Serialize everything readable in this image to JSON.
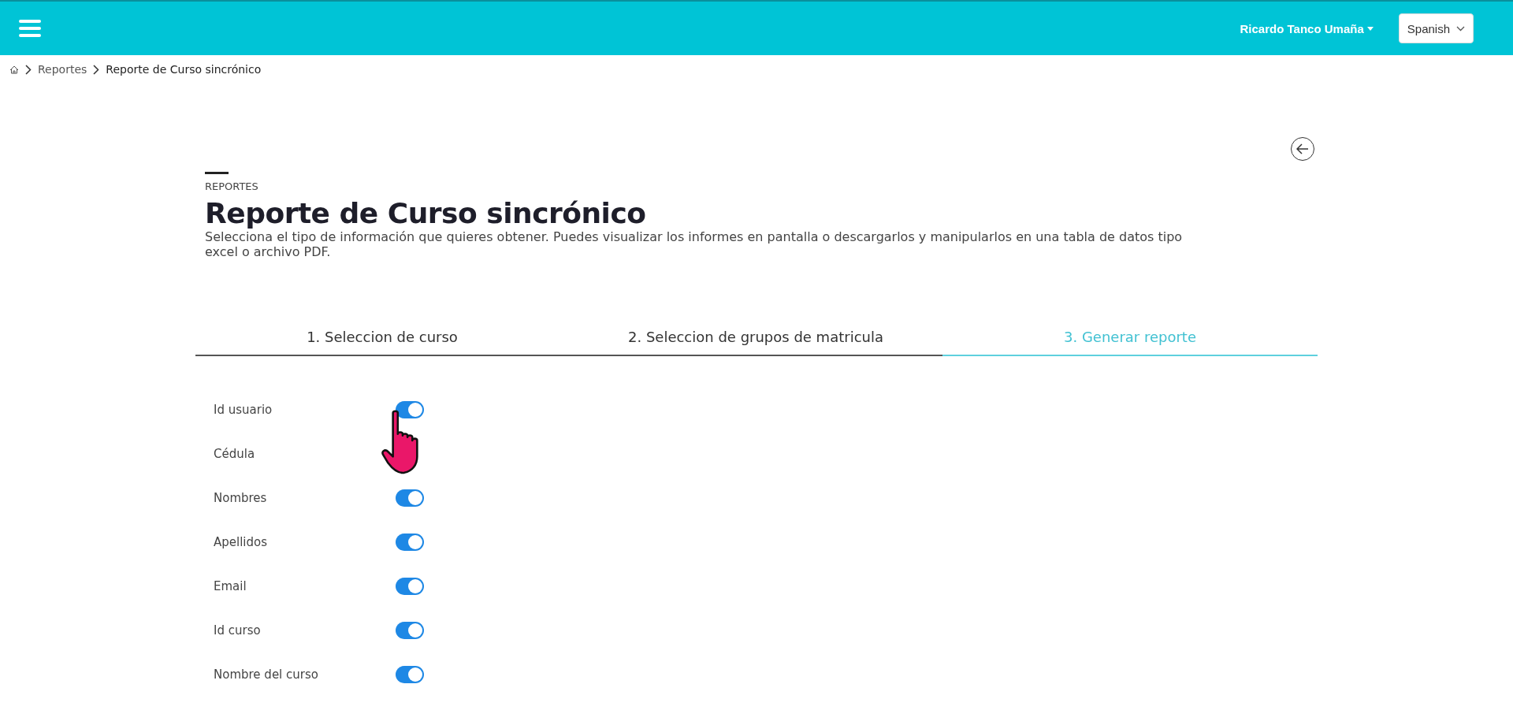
{
  "header": {
    "user": "Ricardo Tanco Umaña",
    "language": "Spanish"
  },
  "breadcrumb": [
    "Reportes",
    "Reporte de Curso sincrónico"
  ],
  "page": {
    "eyebrow": "REPORTES",
    "title": "Reporte de Curso sincrónico",
    "description": "Selecciona el tipo de información que quieres obtener. Puedes visualizar los informes en pantalla o descargarlos y manipularlos en una tabla de datos tipo excel o archivo PDF."
  },
  "steps": [
    {
      "label": "1. Seleccion de curso",
      "selected": false
    },
    {
      "label": "2. Seleccion de grupos de matricula",
      "selected": false
    },
    {
      "label": "3. Generar reporte",
      "selected": true
    }
  ],
  "fields": [
    {
      "label": "Id usuario",
      "on": true
    },
    {
      "label": "Cédula"
    },
    {
      "label": "Nombres",
      "on": true
    },
    {
      "label": "Apellidos",
      "on": true
    },
    {
      "label": "Email",
      "on": true
    },
    {
      "label": "Id curso",
      "on": true
    },
    {
      "label": "Nombre del curso",
      "on": true
    }
  ]
}
